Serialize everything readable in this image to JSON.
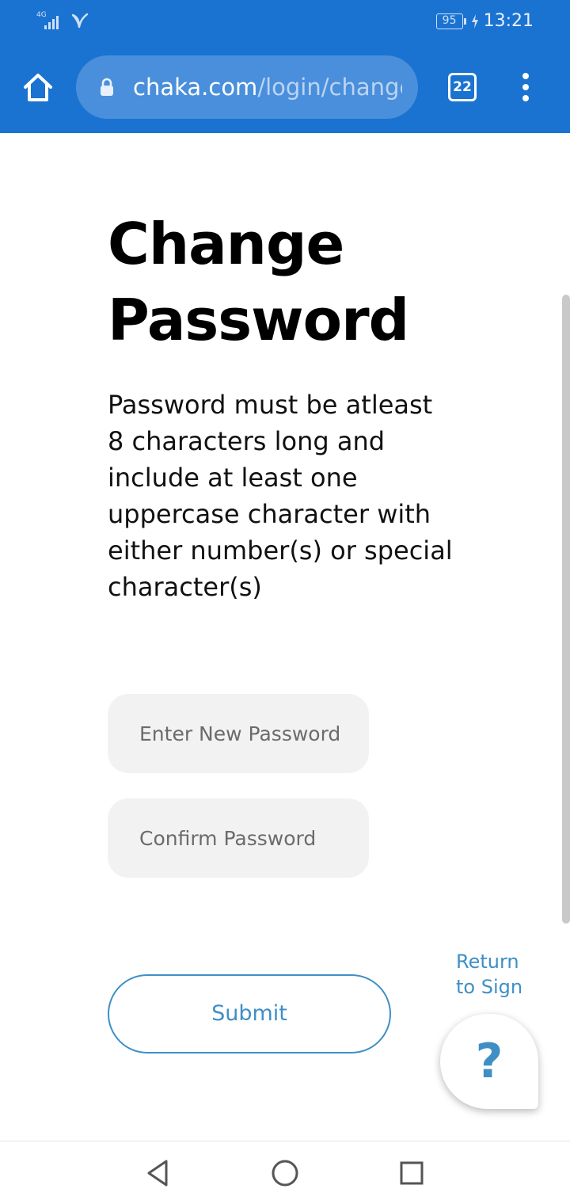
{
  "status_bar": {
    "network_type": "4G",
    "battery": "95",
    "time": "13:21"
  },
  "browser": {
    "url_domain": "chaka.com",
    "url_path": "/login/change",
    "tab_count": "22",
    "icons": {
      "home": "home-icon",
      "lock": "lock-icon",
      "menu": "more-vert-icon"
    },
    "colors": {
      "toolbar": "#1a73d1",
      "url_bar": "#4a8fdc"
    }
  },
  "page": {
    "title": "Change Password",
    "description": "Password must be atleast 8 characters long and include at least one uppercase character with either number(s) or special character(s)",
    "new_password_placeholder": "Enter New Password",
    "confirm_password_placeholder": "Confirm Password",
    "submit_label": "Submit",
    "return_link": "Return to Sign",
    "help_label": "?",
    "colors": {
      "accent": "#3f8fc6",
      "field_background": "#f2f2f2"
    }
  },
  "navigation_bar": {
    "icons": [
      "back-icon",
      "home-icon",
      "recent-apps-icon"
    ]
  }
}
